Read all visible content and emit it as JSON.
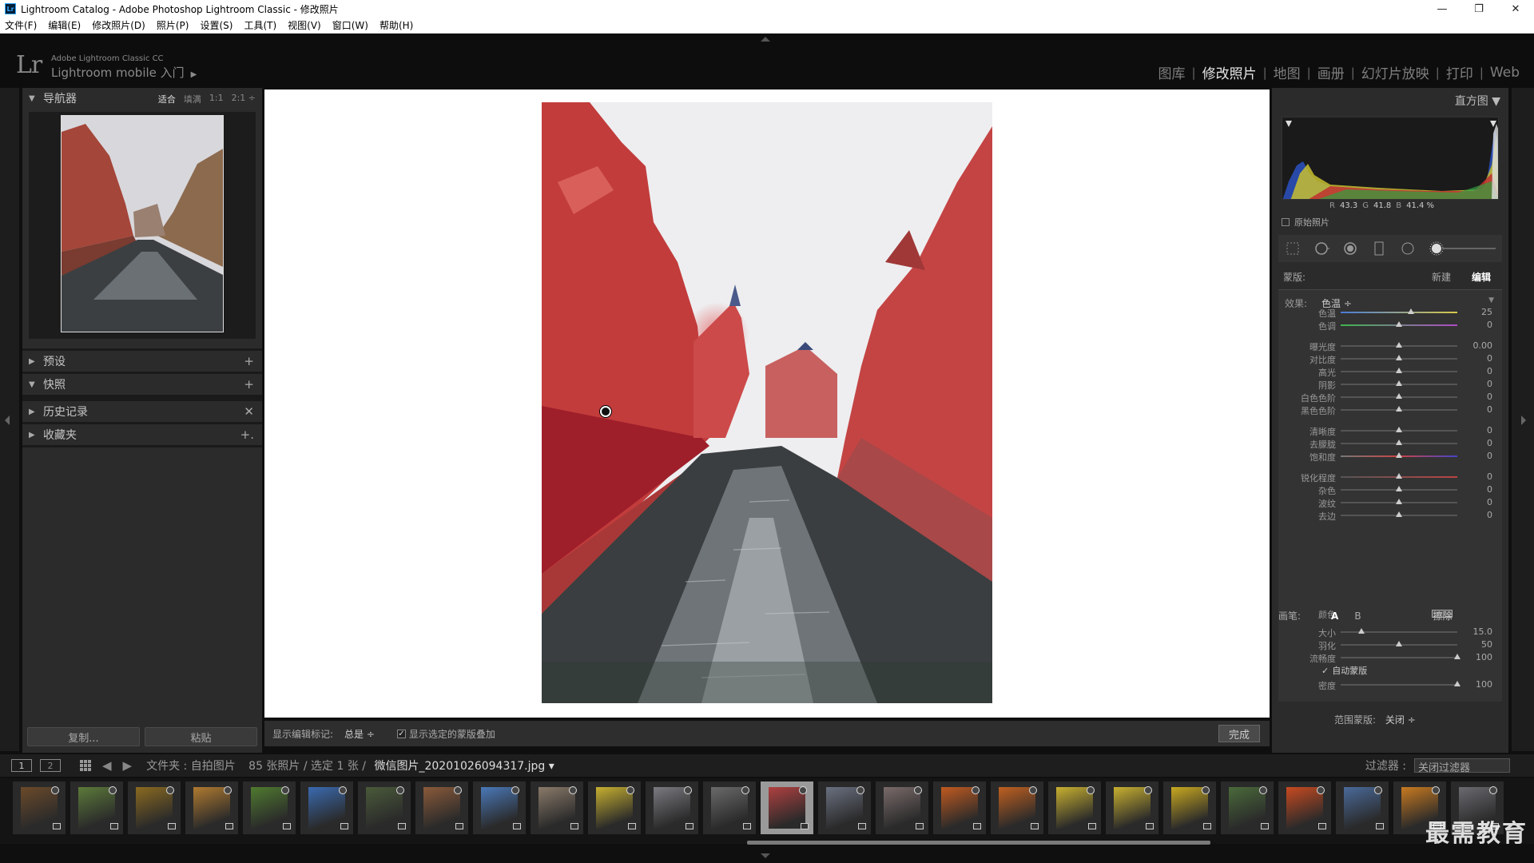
{
  "window": {
    "title": "Lightroom Catalog - Adobe Photoshop Lightroom Classic - 修改照片",
    "lr_badge": "Lr",
    "minimize": "—",
    "maximize": "❐",
    "close": "✕"
  },
  "menu": [
    "文件(F)",
    "编辑(E)",
    "修改照片(D)",
    "照片(P)",
    "设置(S)",
    "工具(T)",
    "视图(V)",
    "窗口(W)",
    "帮助(H)"
  ],
  "identity": {
    "logo": "Lr",
    "line1": "Adobe Lightroom Classic CC",
    "line2": "Lightroom mobile 入门",
    "play": "▶"
  },
  "modules": [
    "图库",
    "修改照片",
    "地图",
    "画册",
    "幻灯片放映",
    "打印",
    "Web"
  ],
  "modules_sep": "|",
  "active_module": "修改照片",
  "left_panel": {
    "navigator": {
      "title": "导航器",
      "opts": [
        "适合",
        "填满",
        "1:1",
        "2:1 ÷"
      ]
    },
    "sections": [
      {
        "label": "预设",
        "action": "+"
      },
      {
        "label": "快照",
        "action": "+"
      },
      {
        "label": "历史记录",
        "action": "✕"
      },
      {
        "label": "收藏夹",
        "action": "+."
      }
    ],
    "copy": "复制...",
    "paste": "粘贴"
  },
  "toolbar": {
    "show_label": "显示编辑标记:",
    "show_value": "总是 ÷",
    "overlay_label": "显示选定的蒙版叠加",
    "done": "完成"
  },
  "right_panel": {
    "histogram_title": "直方图 ▼",
    "rgb": {
      "r_label": "R",
      "r": "43.3",
      "g_label": "G",
      "g": "41.8",
      "b_label": "B",
      "b": "41.4 %"
    },
    "original": "原始照片",
    "mask": {
      "label": "蒙版:",
      "new": "新建",
      "edit": "编辑"
    },
    "effect_label": "效果:",
    "effect_value": "色温 ÷",
    "sliders": [
      {
        "label": "色温",
        "value": "25",
        "pos": 0.6,
        "color": "linear-gradient(90deg,#4a7bd6,#d8c94a)"
      },
      {
        "label": "色调",
        "value": "0",
        "pos": 0.5,
        "color": "linear-gradient(90deg,#3fb44f,#b04ac6)"
      },
      {
        "label": "曝光度",
        "value": "0.00",
        "pos": 0.5
      },
      {
        "label": "对比度",
        "value": "0",
        "pos": 0.5
      },
      {
        "label": "高光",
        "value": "0",
        "pos": 0.5
      },
      {
        "label": "阴影",
        "value": "0",
        "pos": 0.5
      },
      {
        "label": "白色色阶",
        "value": "0",
        "pos": 0.5
      },
      {
        "label": "黑色色阶",
        "value": "0",
        "pos": 0.5
      },
      {
        "label": "清晰度",
        "value": "0",
        "pos": 0.5
      },
      {
        "label": "去朦胧",
        "value": "0",
        "pos": 0.5
      },
      {
        "label": "饱和度",
        "value": "0",
        "pos": 0.5,
        "color": "linear-gradient(90deg,#777,#c44,#44c)"
      },
      {
        "label": "锐化程度",
        "value": "0",
        "pos": 0.5,
        "color": "linear-gradient(90deg,#555,#b44)"
      },
      {
        "label": "杂色",
        "value": "0",
        "pos": 0.5
      },
      {
        "label": "波纹",
        "value": "0",
        "pos": 0.5
      },
      {
        "label": "去边",
        "value": "0",
        "pos": 0.5
      }
    ],
    "color_label": "颜色",
    "brush": {
      "label": "画笔:",
      "a": "A",
      "b": "B",
      "erase": "擦除"
    },
    "brush_sliders": [
      {
        "label": "大小",
        "value": "15.0",
        "pos": 0.18
      },
      {
        "label": "羽化",
        "value": "50",
        "pos": 0.5
      },
      {
        "label": "流畅度",
        "value": "100",
        "pos": 1.0
      }
    ],
    "auto_mask": "自动蒙版",
    "density": {
      "label": "密度",
      "value": "100",
      "pos": 1.0
    },
    "range_mask_label": "范围蒙版:",
    "range_mask_value": "关闭 ÷"
  },
  "filmbar": {
    "page1": "1",
    "page2": "2",
    "prev": "◀",
    "next": "▶",
    "folder": "文件夹 : 自拍图片",
    "count": "85 张照片 / 选定 1 张 /",
    "filename": "微信图片_20201026094317.jpg ▾",
    "filter_label": "过滤器 :",
    "filter_value": "关闭过滤器"
  },
  "filmstrip": [
    {
      "c": "#6b4a2a"
    },
    {
      "c": "#5c7a3a"
    },
    {
      "c": "#8a6a20"
    },
    {
      "c": "#b07a30"
    },
    {
      "c": "#4f7a2f"
    },
    {
      "c": "#3a6ab0"
    },
    {
      "c": "#4a5a3a"
    },
    {
      "c": "#8a5a3a"
    },
    {
      "c": "#4a78b8"
    },
    {
      "c": "#8a7a6a"
    },
    {
      "c": "#c7b030"
    },
    {
      "c": "#7a7a80"
    },
    {
      "c": "#6a6a6a"
    },
    {
      "c": "#b04040"
    },
    {
      "c": "#6a7080"
    },
    {
      "c": "#7a6a6a"
    },
    {
      "c": "#c05a20"
    },
    {
      "c": "#c06020"
    },
    {
      "c": "#c8b030"
    },
    {
      "c": "#c8b030"
    },
    {
      "c": "#c8a820"
    },
    {
      "c": "#4a6a3a"
    },
    {
      "c": "#c84a20"
    },
    {
      "c": "#4a6a9a"
    },
    {
      "c": "#c87a20"
    },
    {
      "c": "#6a6a70"
    }
  ],
  "selected_index": 13,
  "watermark": "最需教育"
}
